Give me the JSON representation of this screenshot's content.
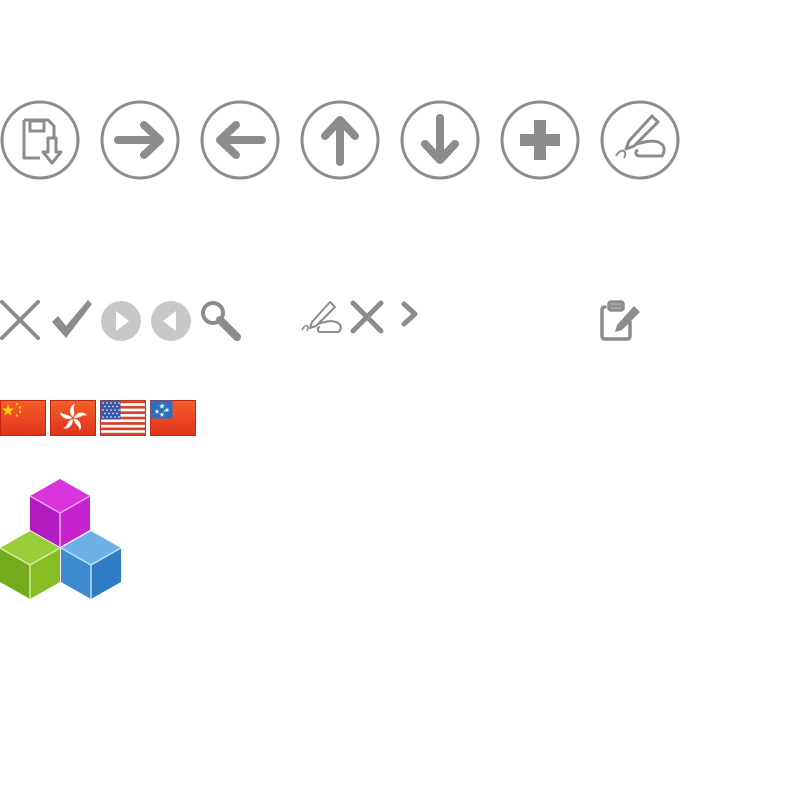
{
  "icons": {
    "large": [
      "save-icon",
      "arrow-right-icon",
      "arrow-left-icon",
      "arrow-up-icon",
      "arrow-down-icon",
      "plus-icon",
      "sign-icon"
    ],
    "small": [
      "close-icon",
      "check-icon",
      "play-next-icon",
      "play-previous-icon",
      "search-icon",
      "sign-icon",
      "close-icon",
      "chevron-right-icon",
      "edit-document-icon"
    ],
    "flags": [
      "china-flag",
      "hong-kong-flag",
      "united-states-flag",
      "samoa-flag"
    ],
    "logo": "cubes-logo-icon"
  },
  "colors": {
    "icon_gray": "#8c8c8c",
    "disabled_gray": "#c8c8c8",
    "flag_red": "#ee3b1d",
    "cube_magenta": "#c21ccc",
    "cube_green": "#7eb51e",
    "cube_blue": "#3f8fd0"
  }
}
